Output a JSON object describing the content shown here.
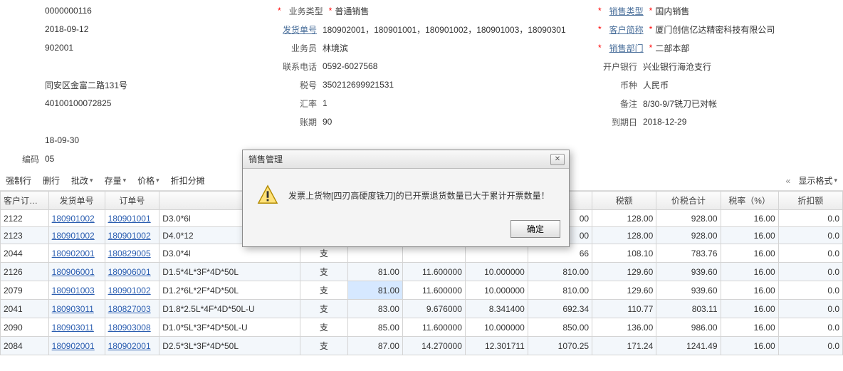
{
  "form": {
    "col1": [
      {
        "label": "",
        "value": "0000000116"
      },
      {
        "label": "",
        "value": "2018-09-12"
      },
      {
        "label": "",
        "value": "902001"
      },
      {
        "label": "",
        "value": ""
      },
      {
        "label": "",
        "value": "同安区金富二路131号"
      },
      {
        "label": "",
        "value": "40100100072825"
      },
      {
        "label": "",
        "value": ""
      },
      {
        "label": "",
        "value": "18-09-30"
      },
      {
        "label": "编码",
        "value": "05"
      }
    ],
    "col2": [
      {
        "label": "业务类型",
        "req": true,
        "value": "普通销售"
      },
      {
        "label": "发货单号",
        "link": true,
        "value": "180902001，180901001，180901002，180901003，18090301"
      },
      {
        "label": "业务员",
        "value": "林境滨"
      },
      {
        "label": "联系电话",
        "value": "0592-6027568"
      },
      {
        "label": "税号",
        "value": "350212699921531"
      },
      {
        "label": "汇率",
        "value": "1"
      },
      {
        "label": "账期",
        "value": "90"
      }
    ],
    "col3": [
      {
        "label": "销售类型",
        "req": true,
        "link": true,
        "value": "国内销售"
      },
      {
        "label": "客户简称",
        "req": true,
        "link": true,
        "value": "厦门创信亿达精密科技有限公司"
      },
      {
        "label": "销售部门",
        "req": true,
        "link": true,
        "value": "二部本部"
      },
      {
        "label": "开户银行",
        "value": "兴业银行海沧支行"
      },
      {
        "label": "币种",
        "value": "人民币"
      },
      {
        "label": "备注",
        "value": "8/30-9/7铣刀已对帐"
      },
      {
        "label": "到期日",
        "value": "2018-12-29"
      }
    ]
  },
  "toolbar": {
    "items": [
      "强制行",
      "删行",
      "批改",
      "存量",
      "价格",
      "折扣分摊"
    ],
    "right_label": "显示格式"
  },
  "table": {
    "headers": [
      "客户订单号",
      "发货单号",
      "订单号",
      "",
      "",
      "",
      "",
      "",
      "",
      "",
      "",
      "税额",
      "价税合计",
      "税率（%）",
      "折扣额"
    ],
    "rows": [
      {
        "c0": "2122",
        "c1": "180901002",
        "c2": "180901001",
        "c3": "D3.0*6l",
        "c4": "",
        "c5": "",
        "c6": "",
        "c7": "",
        "c8": "",
        "c9": "00",
        "c10": "",
        "c11": "128.00",
        "c12": "928.00",
        "c13": "16.00",
        "c14": "0.0"
      },
      {
        "c0": "2123",
        "c1": "180901002",
        "c2": "180901002",
        "c3": "D4.0*12",
        "c4": "",
        "c5": "",
        "c6": "",
        "c7": "",
        "c8": "",
        "c9": "00",
        "c10": "",
        "c11": "128.00",
        "c12": "928.00",
        "c13": "16.00",
        "c14": "0.0"
      },
      {
        "c0": "2044",
        "c1": "180902001",
        "c2": "180829005",
        "c3": "D3.0*4l",
        "c4": "",
        "c5": "支",
        "c6": "",
        "c7": "",
        "c8": "",
        "c9": "66",
        "c10": "",
        "c11": "108.10",
        "c12": "783.76",
        "c13": "16.00",
        "c14": "0.0"
      },
      {
        "c0": "2126",
        "c1": "180906001",
        "c2": "180906001",
        "c3": "D1.5*4L*3F*4D*50L",
        "c4": "",
        "c5": "支",
        "c6": "81.00",
        "c7": "11.600000",
        "c8": "10.000000",
        "c9": "810.00",
        "c10": "",
        "c11": "129.60",
        "c12": "939.60",
        "c13": "16.00",
        "c14": "0.0"
      },
      {
        "c0": "2079",
        "c1": "180901003",
        "c2": "180901002",
        "c3": "D1.2*6L*2F*4D*50L",
        "c4": "",
        "c5": "支",
        "c6": "81.00",
        "c7": "11.600000",
        "c8": "10.000000",
        "c9": "810.00",
        "c10": "",
        "c11": "129.60",
        "c12": "939.60",
        "c13": "16.00",
        "c14": "0.0",
        "sel": 6
      },
      {
        "c0": "2041",
        "c1": "180903011",
        "c2": "180827003",
        "c3": "D1.8*2.5L*4F*4D*50L-U",
        "c4": "",
        "c5": "支",
        "c6": "83.00",
        "c7": "9.676000",
        "c8": "8.341400",
        "c9": "692.34",
        "c10": "",
        "c11": "110.77",
        "c12": "803.11",
        "c13": "16.00",
        "c14": "0.0"
      },
      {
        "c0": "2090",
        "c1": "180903011",
        "c2": "180903008",
        "c3": "D1.0*5L*3F*4D*50L-U",
        "c4": "",
        "c5": "支",
        "c6": "85.00",
        "c7": "11.600000",
        "c8": "10.000000",
        "c9": "850.00",
        "c10": "",
        "c11": "136.00",
        "c12": "986.00",
        "c13": "16.00",
        "c14": "0.0"
      },
      {
        "c0": "2084",
        "c1": "180902001",
        "c2": "180902001",
        "c3": "D2.5*3L*3F*4D*50L",
        "c4": "",
        "c5": "支",
        "c6": "87.00",
        "c7": "14.270000",
        "c8": "12.301711",
        "c9": "1070.25",
        "c10": "",
        "c11": "171.24",
        "c12": "1241.49",
        "c13": "16.00",
        "c14": "0.0"
      }
    ]
  },
  "dialog": {
    "title": "销售管理",
    "text": "发票上货物[四刃高硬度铣刀]的已开票退货数量已大于累计开票数量！",
    "ok": "确定"
  }
}
